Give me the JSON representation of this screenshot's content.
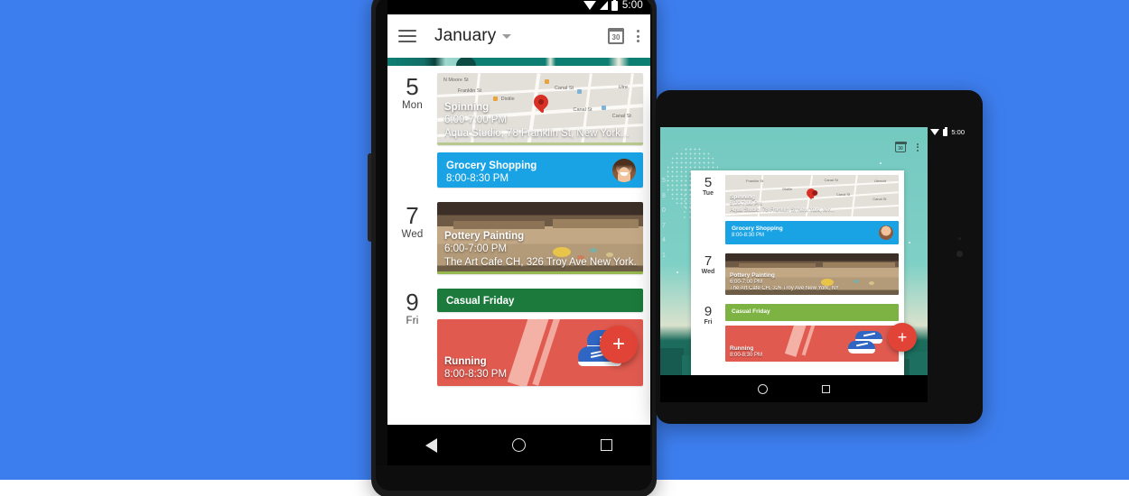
{
  "background": {
    "page_color": "#3d7eef",
    "footer_color": "#ffffff"
  },
  "phone": {
    "device_name": "android-phone",
    "status_bar": {
      "time": "5:00",
      "icons": [
        "wifi-icon",
        "signal-icon",
        "battery-icon"
      ]
    },
    "toolbar": {
      "menu_label": "menu-icon",
      "title": "January",
      "dropdown_label": "chevron-down-icon",
      "calendar_icon_label": "30",
      "overflow_label": "overflow-menu-icon"
    },
    "agenda": {
      "days": [
        {
          "num": "5",
          "dow": "Mon",
          "events": [
            {
              "kind": "map",
              "title": "Spinning",
              "time": "6:00-7:00 PM",
              "location": "Aqua Studio, 78 Franklin St, New York...",
              "color": "#e3e0da",
              "map_labels": [
                "N Moore St",
                "Franklin St",
                "Distile",
                "Canal St",
                "Canal St",
                "Canal St",
                "Utre"
              ]
            },
            {
              "kind": "solid",
              "title": "Grocery Shopping",
              "time": "8:00-8:30 PM",
              "location": "",
              "color": "#19a3e5",
              "avatar": "contact-avatar"
            }
          ]
        },
        {
          "num": "7",
          "dow": "Wed",
          "events": [
            {
              "kind": "photo",
              "title": "Pottery Painting",
              "time": "6:00-7:00 PM",
              "location": "The Art Cafe CH, 326 Troy Ave New York...",
              "color": "#b39a78"
            }
          ]
        },
        {
          "num": "9",
          "dow": "Fri",
          "events": [
            {
              "kind": "solid",
              "title": "Casual Friday",
              "time": "",
              "location": "",
              "color": "#1b7a3c"
            },
            {
              "kind": "photo",
              "title": "Running",
              "time": "8:00-8:30 PM",
              "location": "",
              "color": "#e05a4f"
            }
          ]
        }
      ]
    },
    "fab": {
      "label": "+",
      "color": "#e14437",
      "name": "add-event-button"
    },
    "nav_bar": {
      "back": "back-icon",
      "home": "home-icon",
      "recents": "recents-icon"
    }
  },
  "tablet": {
    "device_name": "android-tablet",
    "status_bar": {
      "time": "5:00",
      "icons": [
        "wifi-icon",
        "battery-icon"
      ]
    },
    "toolbar": {
      "calendar_icon_label": "30",
      "overflow_label": "overflow-menu-icon"
    },
    "wallpaper": {
      "top_color": "#74c9c0",
      "bottom_color": "#176356",
      "name": "city-skyline-wallpaper"
    },
    "edge_numbers": [
      "5",
      "8",
      "0",
      "7",
      "4",
      "1"
    ],
    "agenda": {
      "days": [
        {
          "num": "5",
          "dow": "Tue",
          "events": [
            {
              "kind": "map",
              "title": "Spinning",
              "time": "6:00-7:00 PM",
              "location": "Aqua Studio, 78 Franklin St New York, NY...",
              "color": "#e3e0da"
            },
            {
              "kind": "solid",
              "title": "Grocery Shopping",
              "time": "8:00-8:30 PM",
              "location": "",
              "color": "#19a3e5",
              "avatar": "contact-avatar"
            }
          ]
        },
        {
          "num": "7",
          "dow": "Wed",
          "events": [
            {
              "kind": "photo",
              "title": "Pottery Painting",
              "time": "6:00-7:00 PM",
              "location": "The Art Cafe CH, 326 Troy Ave New York, NY",
              "color": "#b39a78"
            }
          ]
        },
        {
          "num": "9",
          "dow": "Fri",
          "events": [
            {
              "kind": "solid",
              "title": "Casual Friday",
              "time": "",
              "location": "",
              "color": "#7cb342"
            },
            {
              "kind": "photo",
              "title": "Running",
              "time": "8:00-8:30 PM",
              "location": "",
              "color": "#e05a4f"
            }
          ]
        }
      ]
    },
    "fab": {
      "label": "+",
      "color": "#e14437",
      "name": "add-event-button"
    },
    "nav_bar": {
      "home": "home-icon",
      "recents": "recents-icon"
    }
  }
}
